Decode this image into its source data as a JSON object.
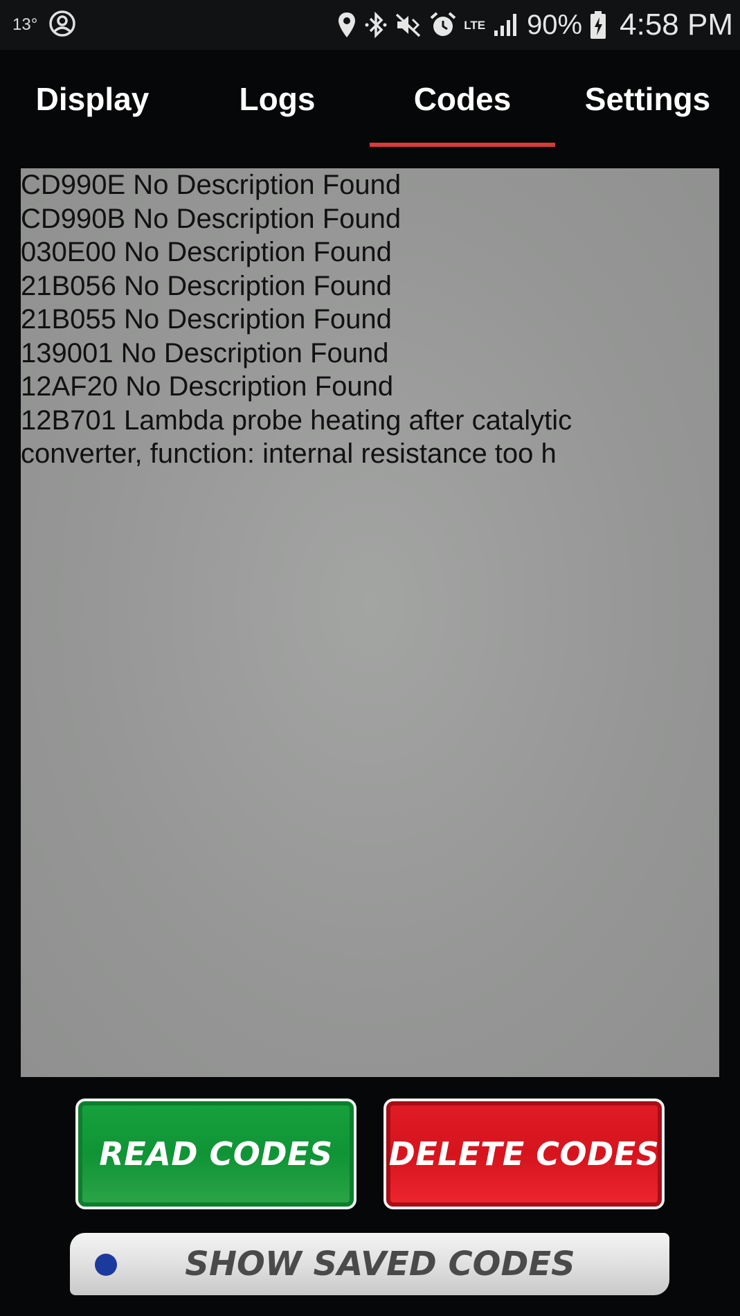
{
  "status_bar": {
    "temperature": "13°",
    "battery": "90%",
    "time": "4:58 PM",
    "network": "LTE",
    "icons": [
      "account-circle-icon",
      "location-pin-icon",
      "bluetooth-icon",
      "vibrate-icon",
      "alarm-icon",
      "lte-icon",
      "signal-icon",
      "battery-charging-icon"
    ]
  },
  "tabs": [
    {
      "label": "Display"
    },
    {
      "label": "Logs"
    },
    {
      "label": "Codes"
    },
    {
      "label": "Settings"
    }
  ],
  "active_tab": "Codes",
  "codes": [
    "CD990E No Description Found",
    "CD990B No Description Found",
    "030E00 No Description Found",
    "21B056 No Description Found",
    "21B055 No Description Found",
    "139001 No Description Found",
    "12AF20 No Description Found",
    "12B701 Lambda probe heating after catalytic converter, function: internal resistance too h"
  ],
  "buttons": {
    "read_codes": "READ CODES",
    "delete_codes": "DELETE CODES",
    "show_saved_codes": "SHOW SAVED CODES"
  },
  "colors": {
    "accent_tab_indicator": "#d83b3b",
    "read_button": "#129a3a",
    "delete_button": "#e01c26",
    "panel_background": "#9a9b9a"
  }
}
